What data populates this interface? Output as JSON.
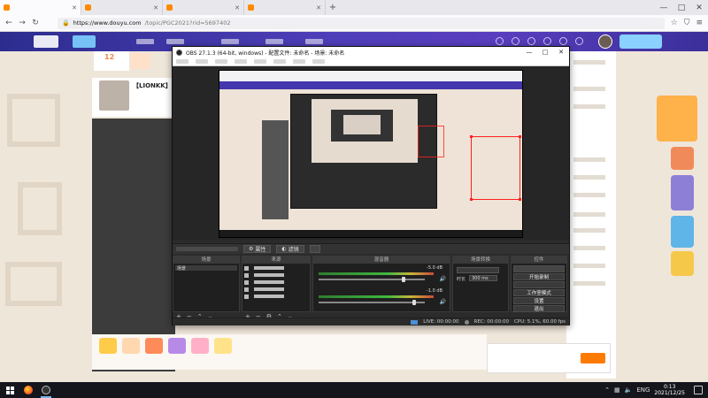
{
  "browser": {
    "tabs": [
      {
        "label": "",
        "active": true
      },
      {
        "label": "",
        "active": false
      },
      {
        "label": "",
        "active": false
      },
      {
        "label": "",
        "active": false
      }
    ],
    "new_tab": "+",
    "window_controls": {
      "minimize": "—",
      "maximize": "□",
      "close": "✕"
    },
    "url": {
      "host": "https://www.douyu.com",
      "path": "/topic/PGC2021?rid=5697402"
    },
    "nav": {
      "back": "←",
      "forward": "→",
      "reload": "↻"
    }
  },
  "site": {
    "stat_number": "12",
    "streamer_name": "【LIONKK】"
  },
  "obs": {
    "title": "OBS 27.1.3 (64-bit, windows) - 配置文件: 未命名 - 场景: 未命名",
    "window_controls": {
      "minimize": "—",
      "maximize": "□",
      "close": "✕"
    },
    "toolbar": {
      "properties": "属性",
      "filters": "滤镜"
    },
    "docks": {
      "scenes": "场景",
      "sources": "来源",
      "mixer": "混音器",
      "transitions": "场景转换",
      "controls": "控件"
    },
    "scenes": [
      "场景"
    ],
    "sources": [
      {
        "name": "",
        "icon": "image-icon"
      },
      {
        "name": "",
        "icon": "monitor-icon"
      },
      {
        "name": "",
        "icon": "text-icon"
      },
      {
        "name": "",
        "icon": "window-icon"
      },
      {
        "name": "",
        "icon": "gamepad-icon"
      }
    ],
    "mixer": [
      {
        "label": "",
        "db": "-5.0 dB",
        "level": 0.8
      },
      {
        "label": "",
        "db": "-1.0 dB",
        "level": 0.9
      }
    ],
    "transitions": {
      "selected": "",
      "duration_label": "时长",
      "duration_value": "300 ms"
    },
    "controls": {
      "start_streaming": "",
      "start_recording": "开始录制",
      "virtual_camera": "",
      "studio_mode": "工作室模式",
      "settings": "设置",
      "exit": "退出"
    },
    "status": {
      "live": "LIVE: 00:00:00",
      "rec": "REC: 00:00:00",
      "cpu": "CPU: 5.1%, 60.00 fps"
    }
  },
  "taskbar": {
    "lang": "ENG",
    "time": "0:13",
    "date": "2021/12/25"
  },
  "colors": {
    "site_header": "#4d3eb8",
    "obs_bg": "#2b2b2b",
    "selection": "#ff2020",
    "accent": "#ff7a00"
  }
}
